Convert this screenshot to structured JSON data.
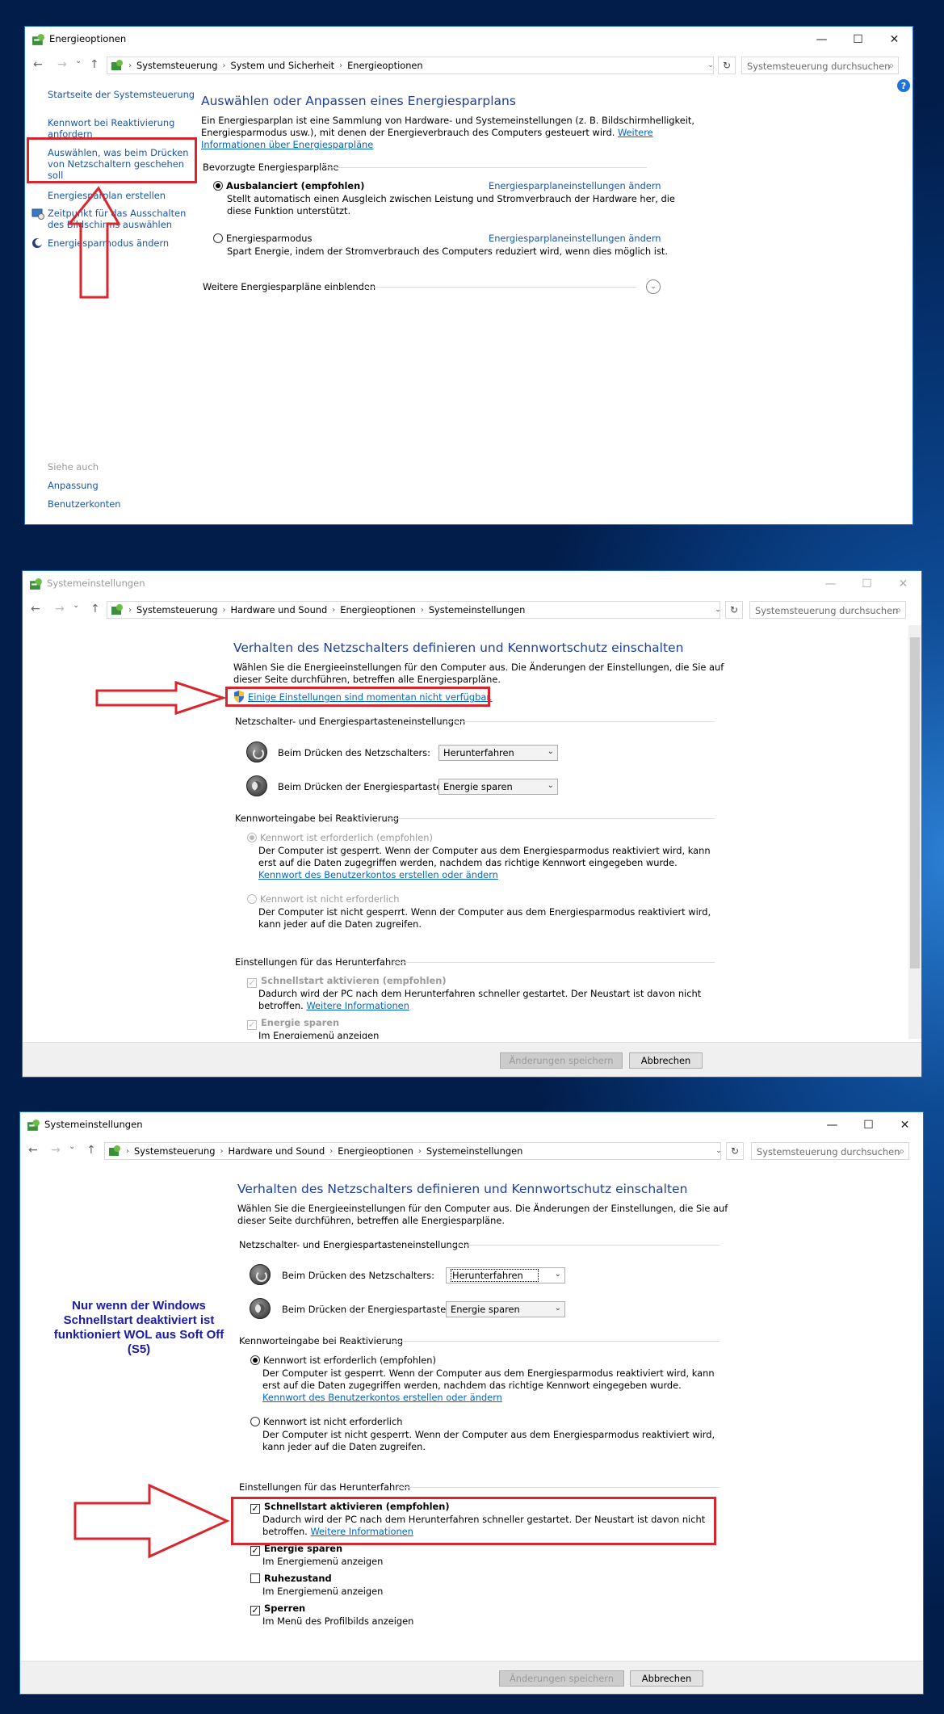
{
  "w1": {
    "title": "Energieoptionen",
    "crumbs": [
      "Systemsteuerung",
      "System und Sicherheit",
      "Energieoptionen"
    ],
    "search": "Systemsteuerung durchsuchen",
    "left": {
      "start": "Startseite der Systemsteuerung",
      "kennwort1": "Kennwort bei Reaktivierung",
      "kennwort2": "anfordern",
      "ausw1": "Auswählen, was beim Drücken",
      "ausw2": "von Netzschaltern geschehen",
      "ausw3": "soll",
      "erstellen": "Energiesparplan erstellen",
      "zeit1": "Zeitpunkt für das Ausschalten",
      "zeit2": "des Bildschirms auswählen",
      "aendern": "Energiesparmodus ändern",
      "siehe": "Siehe auch",
      "anpassung": "Anpassung",
      "konten": "Benutzerkonten"
    },
    "main": {
      "heading": "Auswählen oder Anpassen eines Energiesparplans",
      "desc1": "Ein Energiesparplan ist eine Sammlung von Hardware- und Systemeinstellungen (z. B. Bildschirmhelligkeit,",
      "desc2": "Energiesparmodus usw.), mit denen der Energieverbrauch des Computers gesteuert wird.",
      "desc_link1": "Weitere",
      "desc_link2": "Informationen über Energiesparpläne",
      "bevorzugt": "Bevorzugte Energiesparpläne",
      "plan1": "Ausbalanciert (empfohlen)",
      "plan1_desc1": "Stellt automatisch einen Ausgleich zwischen Leistung und Stromverbrauch der Hardware her, die",
      "plan1_desc2": "diese Funktion unterstützt.",
      "plan_link": "Energiesparplaneinstellungen ändern",
      "plan2": "Energiesparmodus",
      "plan2_desc": "Spart Energie, indem der Stromverbrauch des Computers reduziert wird, wenn dies möglich ist.",
      "more": "Weitere Energiesparpläne einblenden"
    }
  },
  "w2": {
    "title": "Systemeinstellungen",
    "crumbs": [
      "Systemsteuerung",
      "Hardware und Sound",
      "Energieoptionen",
      "Systemeinstellungen"
    ],
    "search": "Systemsteuerung durchsuchen",
    "heading": "Verhalten des Netzschalters definieren und Kennwortschutz einschalten",
    "desc1": "Wählen Sie die Energieeinstellungen für den Computer aus. Die Änderungen der Einstellungen, die Sie auf",
    "desc2": "dieser Seite durchführen, betreffen alle Energiesparpläne.",
    "unavailable": "Einige Einstellungen sind momentan nicht verfügbar.",
    "sec1": "Netzschalter- und Energiespartasteneinstellungen",
    "power_label": "Beim Drücken des Netzschalters:",
    "power_value": "Herunterfahren",
    "sleep_label": "Beim Drücken der Energiespartaste:",
    "sleep_value": "Energie sparen",
    "sec2": "Kennworteingabe bei Reaktivierung",
    "pw_req": "Kennwort ist erforderlich (empfohlen)",
    "pw_req_d1": "Der Computer ist gesperrt. Wenn der Computer aus dem Energiesparmodus reaktiviert wird, kann",
    "pw_req_d2": "erst auf die Daten zugegriffen werden, nachdem das richtige Kennwort eingegeben wurde.",
    "pw_link": "Kennwort des Benutzerkontos erstellen oder ändern",
    "pw_not": "Kennwort ist nicht erforderlich",
    "pw_not_d1": "Der Computer ist nicht gesperrt. Wenn der Computer aus dem Energiesparmodus reaktiviert wird,",
    "pw_not_d2": "kann jeder auf die Daten zugreifen.",
    "sec3": "Einstellungen für das Herunterfahren",
    "fast": "Schnellstart aktivieren (empfohlen)",
    "fast_d1": "Dadurch wird der PC nach dem Herunterfahren schneller gestartet. Der Neustart ist davon nicht",
    "fast_d2": "betroffen.",
    "fast_link": "Weitere Informationen",
    "sleep": "Energie sparen",
    "sleep_d": "Im Energiemenü anzeigen",
    "save": "Änderungen speichern",
    "cancel": "Abbrechen"
  },
  "w3": {
    "title": "Systemeinstellungen",
    "crumbs": [
      "Systemsteuerung",
      "Hardware und Sound",
      "Energieoptionen",
      "Systemeinstellungen"
    ],
    "search": "Systemsteuerung durchsuchen",
    "heading": "Verhalten des Netzschalters definieren und Kennwortschutz einschalten",
    "desc1": "Wählen Sie die Energieeinstellungen für den Computer aus. Die Änderungen der Einstellungen, die Sie auf",
    "desc2": "dieser Seite durchführen, betreffen alle Energiesparpläne.",
    "sec1": "Netzschalter- und Energiespartasteneinstellungen",
    "power_label": "Beim Drücken des Netzschalters:",
    "power_value": "Herunterfahren",
    "sleep_label": "Beim Drücken der Energiespartaste:",
    "sleep_value": "Energie sparen",
    "sec2": "Kennworteingabe bei Reaktivierung",
    "pw_req": "Kennwort ist erforderlich (empfohlen)",
    "pw_req_d1": "Der Computer ist gesperrt. Wenn der Computer aus dem Energiesparmodus reaktiviert wird, kann",
    "pw_req_d2": "erst auf die Daten zugegriffen werden, nachdem das richtige Kennwort eingegeben wurde.",
    "pw_link": "Kennwort des Benutzerkontos erstellen oder ändern",
    "pw_not": "Kennwort ist nicht erforderlich",
    "pw_not_d1": "Der Computer ist nicht gesperrt. Wenn der Computer aus dem Energiesparmodus reaktiviert wird,",
    "pw_not_d2": "kann jeder auf die Daten zugreifen.",
    "sec3": "Einstellungen für das Herunterfahren",
    "fast": "Schnellstart aktivieren (empfohlen)",
    "fast_d1": "Dadurch wird der PC nach dem Herunterfahren schneller gestartet. Der Neustart ist davon nicht",
    "fast_d2": "betroffen.",
    "fast_link": "Weitere Informationen",
    "sleep": "Energie sparen",
    "sleep_d": "Im Energiemenü anzeigen",
    "hib": "Ruhezustand",
    "hib_d": "Im Energiemenü anzeigen",
    "lock": "Sperren",
    "lock_d": "Im Menü des Profilbilds anzeigen",
    "save": "Änderungen speichern",
    "cancel": "Abbrechen",
    "note1": "Nur wenn der Windows",
    "note2": "Schnellstart deaktiviert ist",
    "note3": "funktioniert WOL aus Soft Off",
    "note4": "(S5)"
  },
  "icons": {
    "help": "?",
    "back": "←",
    "forward": "→",
    "up": "↑",
    "refresh": "↻",
    "minimize": "—",
    "maximize": "☐",
    "close": "✕",
    "search": "⌕",
    "dropdown": "⌄",
    "check": "✓"
  },
  "colors": {
    "accent": "#1e3f9a",
    "link": "#0066cc",
    "annotation": "#d7262e",
    "note": "#1a1aa8"
  }
}
